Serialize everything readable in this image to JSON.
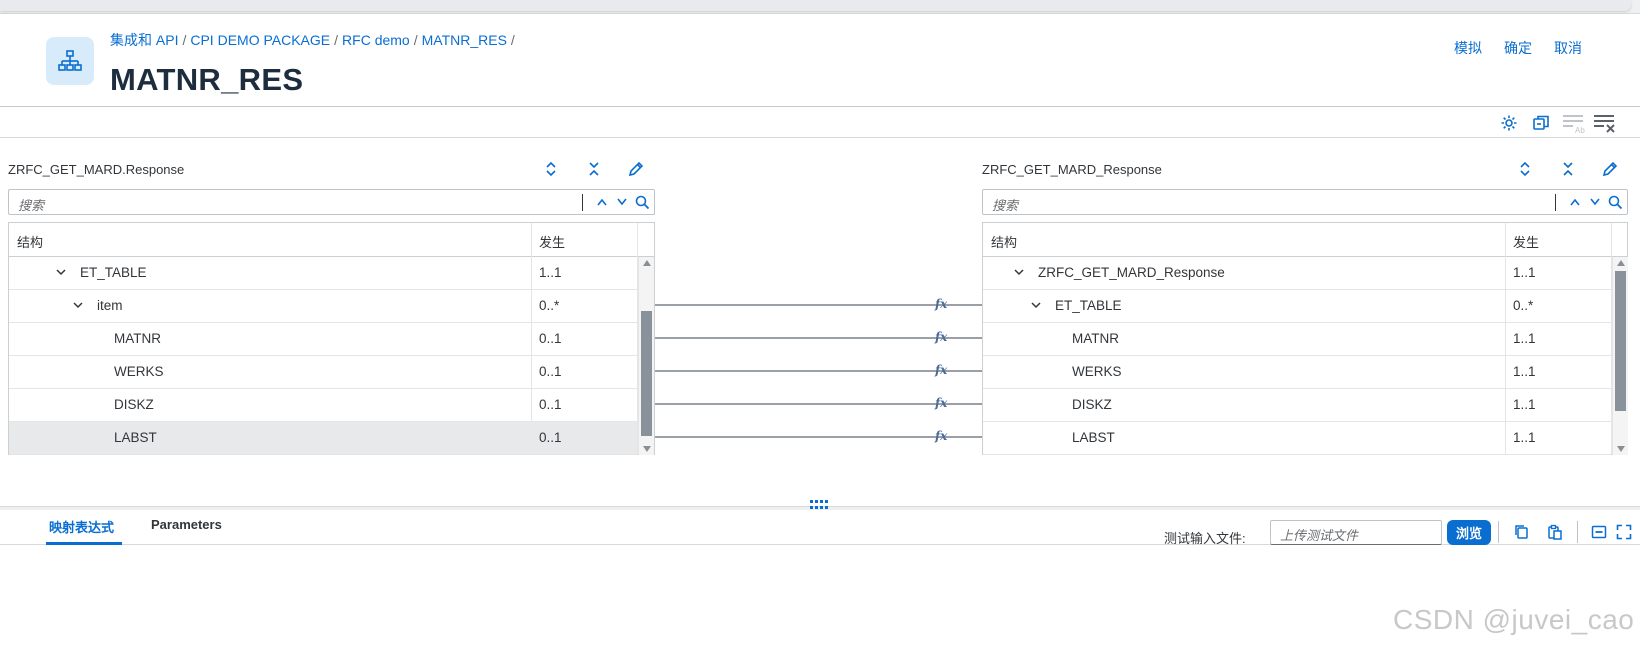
{
  "breadcrumb": [
    "集成和 API",
    "CPI DEMO PACKAGE",
    "RFC demo",
    "MATNR_RES"
  ],
  "page_title": "MATNR_RES",
  "header_actions": {
    "simulate": "模拟",
    "ok": "确定",
    "cancel": "取消"
  },
  "toolbar_icons": [
    "settings-icon",
    "copy-mapping-icon",
    "filter-text-icon",
    "clear-filter-icon"
  ],
  "source": {
    "title": "ZRFC_GET_MARD.Response",
    "search_placeholder": "搜索",
    "col_structure": "结构",
    "col_occurrence": "发生",
    "rows": [
      {
        "name": "ET_TABLE",
        "occ": "1..1",
        "expand": true
      },
      {
        "name": "item",
        "occ": "0..*",
        "expand": true
      },
      {
        "name": "MATNR",
        "occ": "0..1",
        "expand": false
      },
      {
        "name": "WERKS",
        "occ": "0..1",
        "expand": false
      },
      {
        "name": "DISKZ",
        "occ": "0..1",
        "expand": false
      },
      {
        "name": "LABST",
        "occ": "0..1",
        "expand": false,
        "selected": true
      }
    ]
  },
  "target": {
    "title": "ZRFC_GET_MARD_Response",
    "search_placeholder": "搜索",
    "col_structure": "结构",
    "col_occurrence": "发生",
    "rows": [
      {
        "name": "ZRFC_GET_MARD_Response",
        "occ": "1..1",
        "expand": true
      },
      {
        "name": "ET_TABLE",
        "occ": "0..*",
        "expand": true
      },
      {
        "name": "MATNR",
        "occ": "1..1",
        "expand": false
      },
      {
        "name": "WERKS",
        "occ": "1..1",
        "expand": false
      },
      {
        "name": "DISKZ",
        "occ": "1..1",
        "expand": false
      },
      {
        "name": "LABST",
        "occ": "1..1",
        "expand": false
      }
    ]
  },
  "mapping_fx_label": "fx",
  "tabs": {
    "expression": "映射表达式",
    "parameters": "Parameters"
  },
  "test_file": {
    "label": "测试输入文件:",
    "placeholder": "上传测试文件",
    "browse": "浏览"
  },
  "watermark": "CSDN @juvei_cao",
  "colors": {
    "accent": "#0a6ed1",
    "title": "#1d2d3e",
    "icon_bg": "#d8ebfa"
  }
}
